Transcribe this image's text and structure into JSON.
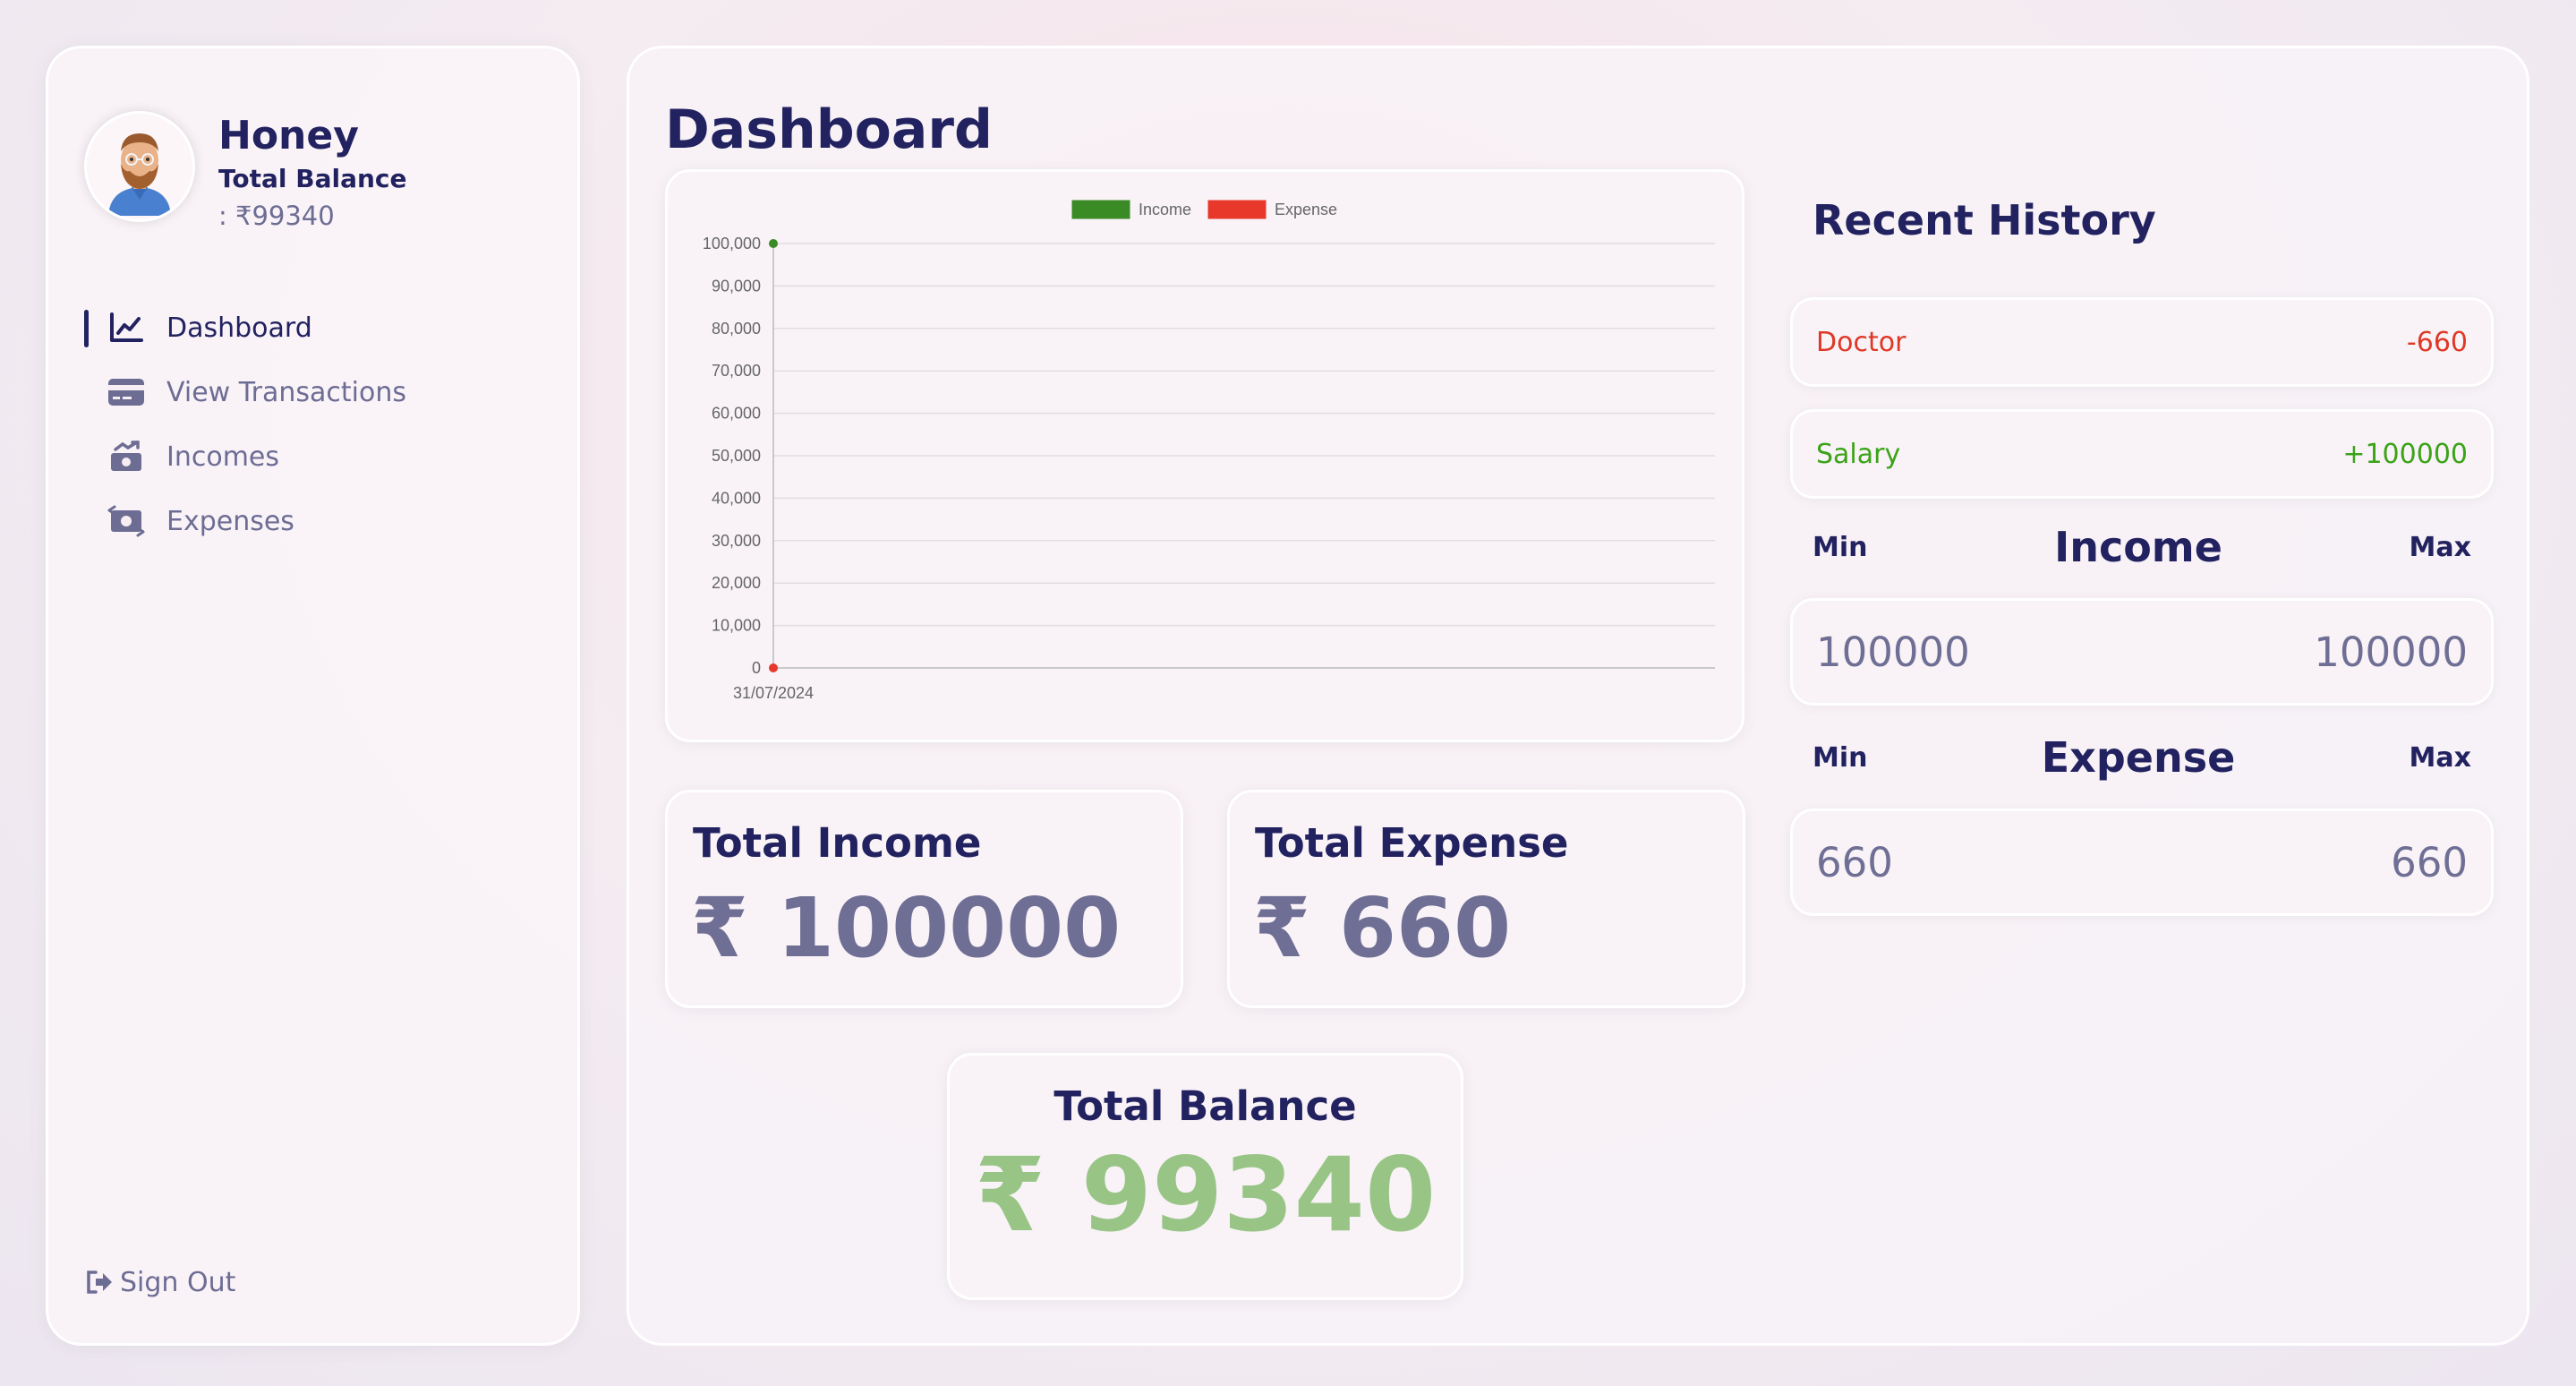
{
  "sidebar": {
    "user_name": "Honey",
    "balance_label": "Total Balance",
    "balance_value": ": ₹99340",
    "menu": [
      {
        "label": "Dashboard",
        "icon": "chart-line-icon",
        "active": true
      },
      {
        "label": "View Transactions",
        "icon": "credit-card-icon",
        "active": false
      },
      {
        "label": "Incomes",
        "icon": "money-trend-up-icon",
        "active": false
      },
      {
        "label": "Expenses",
        "icon": "money-bill-transfer-icon",
        "active": false
      }
    ],
    "signout_label": "Sign Out"
  },
  "main": {
    "title": "Dashboard",
    "total_income": {
      "label": "Total Income",
      "value": "₹ 100000"
    },
    "total_expense": {
      "label": "Total Expense",
      "value": "₹ 660"
    },
    "total_balance": {
      "label": "Total Balance",
      "value": "₹ 99340"
    }
  },
  "history": {
    "title": "Recent History",
    "items": [
      {
        "name": "Doctor",
        "amount": "-660",
        "kind": "expense"
      },
      {
        "name": "Salary",
        "amount": "+100000",
        "kind": "income"
      }
    ],
    "income_range": {
      "title": "Income",
      "min_label": "Min",
      "max_label": "Max",
      "min": "100000",
      "max": "100000"
    },
    "expense_range": {
      "title": "Expense",
      "min_label": "Min",
      "max_label": "Max",
      "min": "660",
      "max": "660"
    }
  },
  "colors": {
    "income": "#3a8a26",
    "expense": "#e8382b",
    "balance_green": "#98c586",
    "navy": "#222260"
  },
  "chart_data": {
    "type": "line",
    "x": [
      "31/07/2024"
    ],
    "series": [
      {
        "name": "Income",
        "values": [
          100000
        ],
        "color": "#3a8a26"
      },
      {
        "name": "Expense",
        "values": [
          0
        ],
        "color": "#e8382b"
      }
    ],
    "yticks": [
      "0",
      "10,000",
      "20,000",
      "30,000",
      "40,000",
      "50,000",
      "60,000",
      "70,000",
      "80,000",
      "90,000",
      "100,000"
    ],
    "ylim": [
      0,
      100000
    ],
    "grid": true,
    "legend": "top-center"
  }
}
